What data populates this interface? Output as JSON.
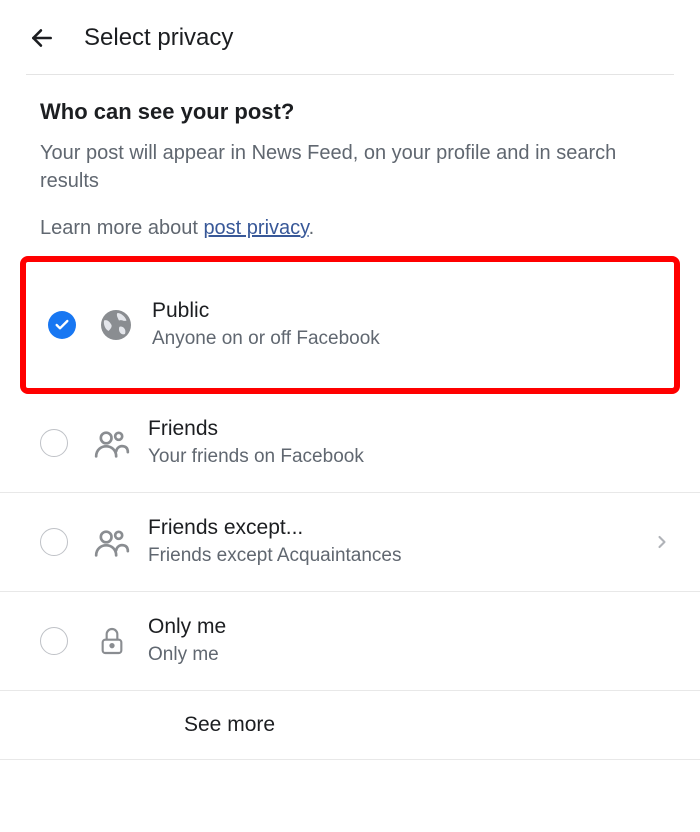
{
  "header": {
    "title": "Select privacy"
  },
  "section": {
    "heading": "Who can see your post?",
    "description": "Your post will appear in News Feed, on your profile and in search results",
    "learn_more_prefix": "Learn more about ",
    "learn_more_link": "post privacy",
    "learn_more_suffix": "."
  },
  "options": {
    "public": {
      "title": "Public",
      "subtitle": "Anyone on or off Facebook",
      "selected": true
    },
    "friends": {
      "title": "Friends",
      "subtitle": "Your friends on Facebook",
      "selected": false
    },
    "friends_except": {
      "title": "Friends except...",
      "subtitle": "Friends except Acquaintances",
      "selected": false
    },
    "only_me": {
      "title": "Only me",
      "subtitle": "Only me",
      "selected": false
    }
  },
  "see_more": {
    "label": "See more"
  }
}
